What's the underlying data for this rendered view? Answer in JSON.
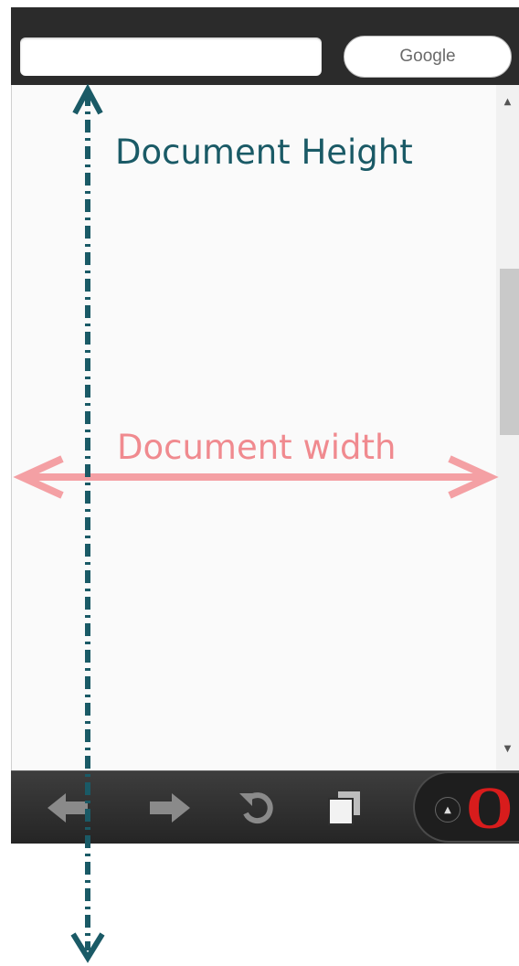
{
  "browser": {
    "url_value": "",
    "search_placeholder": "Google",
    "toolbar": {
      "back_icon": "arrow-left-icon",
      "forward_icon": "arrow-right-icon",
      "reload_icon": "reload-icon",
      "tabs_icon": "tabs-icon",
      "menu_caret": "▲",
      "opera_logo": "O"
    }
  },
  "annotations": {
    "height_label": "Document Height",
    "width_label": "Document width",
    "height_color": "#1a5a66",
    "width_color": "#f08a8f"
  }
}
